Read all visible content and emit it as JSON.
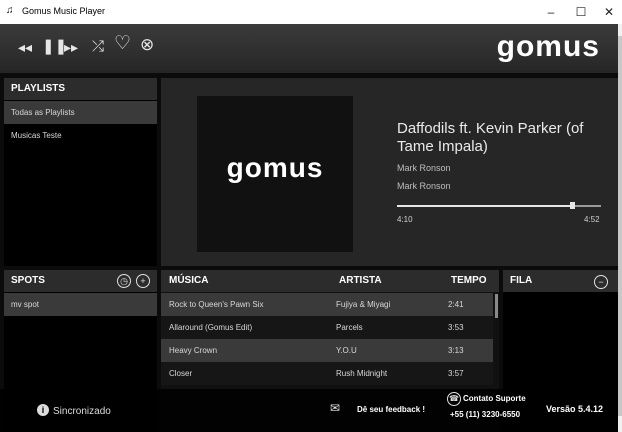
{
  "window": {
    "title": "Gomus Music Player",
    "app_icon": "music-note-icon",
    "minimize": "–",
    "maximize": "☐",
    "close": "✕"
  },
  "topbar": {
    "logo": "gomus",
    "controls": [
      {
        "name": "previous-icon",
        "glyph": "◂◂"
      },
      {
        "name": "pause-icon",
        "glyph": "❚❚"
      },
      {
        "name": "next-icon",
        "glyph": "▸▸"
      },
      {
        "name": "shuffle-icon",
        "glyph": "⤮"
      },
      {
        "name": "heart-icon",
        "glyph": "♡"
      },
      {
        "name": "close-circle-icon",
        "glyph": "⊗"
      }
    ]
  },
  "playlists": {
    "header": "PLAYLISTS",
    "items": [
      {
        "label": "Todas as Playlists",
        "selected": true
      },
      {
        "label": "Musicas Teste",
        "selected": false
      }
    ]
  },
  "now_playing": {
    "art_logo": "gomus",
    "title": "Daffodils ft. Kevin Parker (of Tame Impala)",
    "artist_1": "Mark Ronson",
    "artist_2": "Mark Ronson",
    "elapsed": "4:10",
    "duration": "4:52",
    "progress_fraction": 0.86
  },
  "spots": {
    "header": "SPOTS",
    "items": [
      {
        "label": "mv spot"
      }
    ]
  },
  "tracks": {
    "columns": {
      "music": "MÚSICA",
      "artist": "ARTISTA",
      "time": "TEMPO"
    },
    "rows": [
      {
        "music": "Rock to Queen's Pawn Six",
        "artist": "Fujiya & Miyagi",
        "time": "2:41"
      },
      {
        "music": "Allaround (Gomus Edit)",
        "artist": "Parcels",
        "time": "3:53"
      },
      {
        "music": "Heavy Crown",
        "artist": "Y.O.U",
        "time": "3:13"
      },
      {
        "music": "Closer",
        "artist": "Rush Midnight",
        "time": "3:57"
      }
    ]
  },
  "queue": {
    "header": "FILA"
  },
  "status_bar": {
    "sync_label": "Sincronizado",
    "feedback_label": "Dê seu feedback !",
    "support_label": "Contato Suporte",
    "support_phone": "+55 (11) 3230-6550",
    "version": "Versão 5.4.12"
  },
  "colors": {
    "background": "#0b0b0b",
    "panel_header": "#2c2c2c",
    "selected_row": "#3a3a3a",
    "text": "#ffffff"
  }
}
